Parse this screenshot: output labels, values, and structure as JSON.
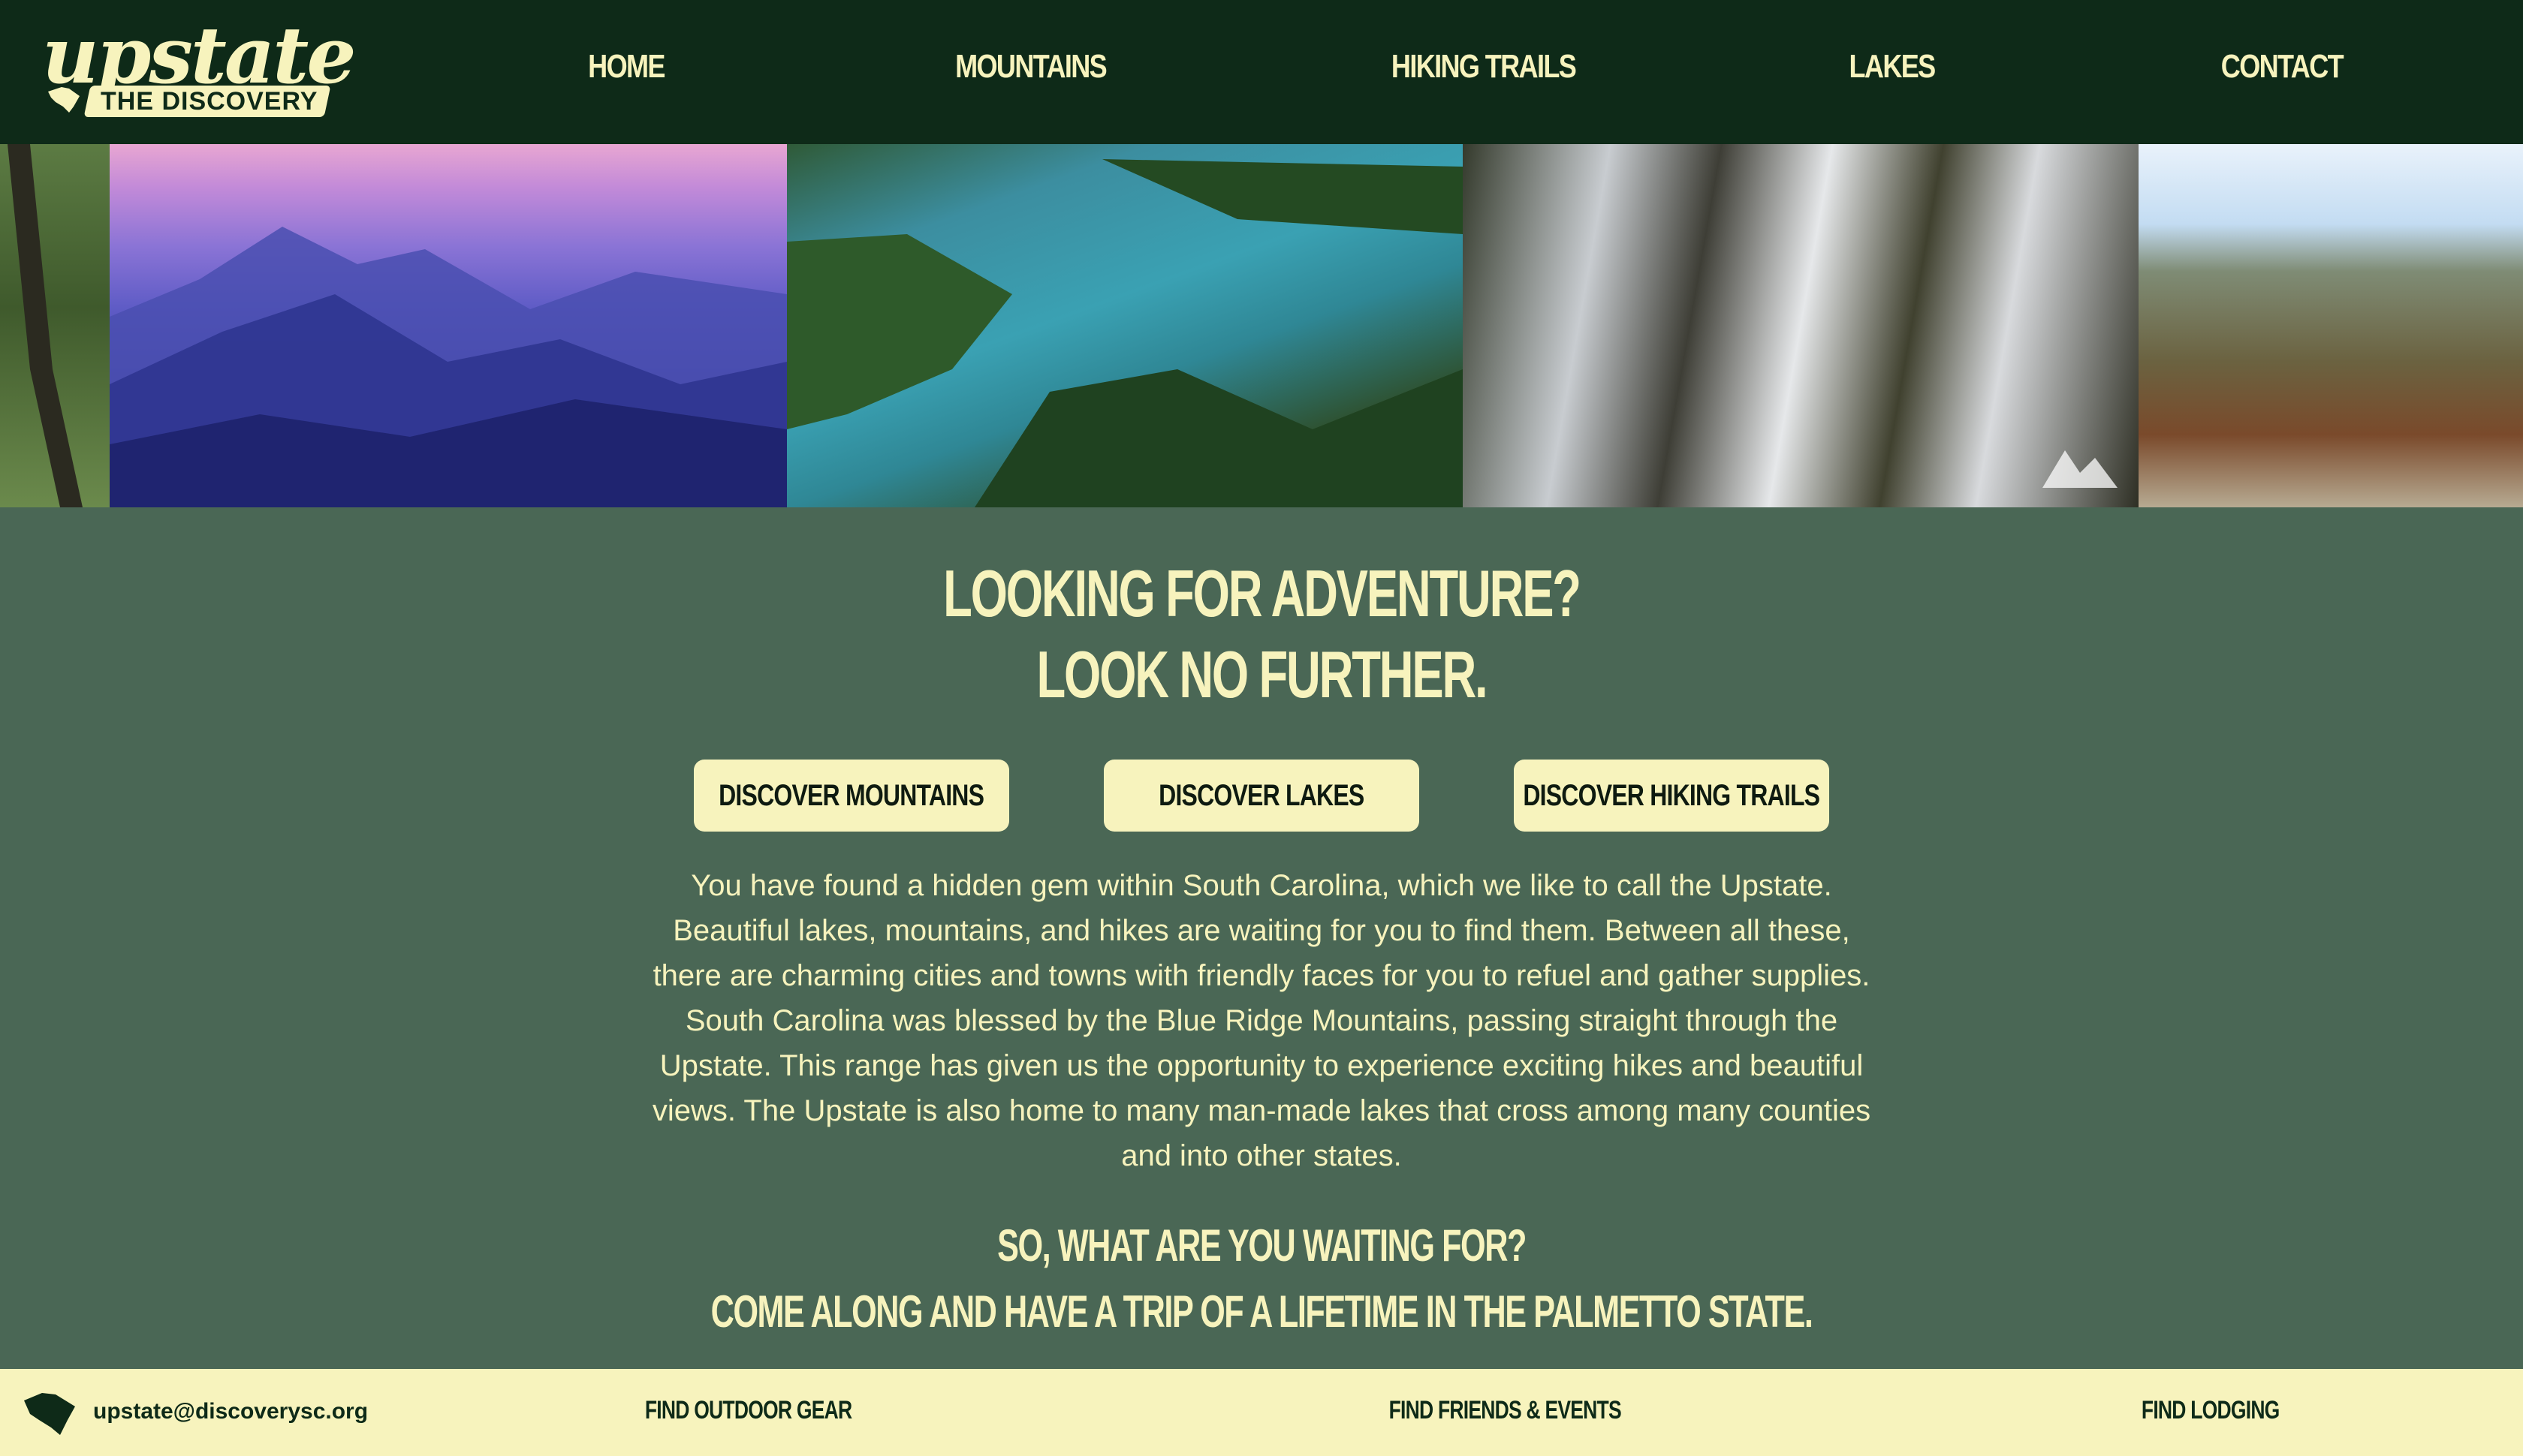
{
  "brand": {
    "logo_word": "upstate",
    "logo_sub": "THE DISCOVERY"
  },
  "nav": {
    "items": [
      {
        "label": "HOME"
      },
      {
        "label": "MOUNTAINS"
      },
      {
        "label": "HIKING TRAILS"
      },
      {
        "label": "LAKES"
      },
      {
        "label": "CONTACT"
      }
    ]
  },
  "banner": {
    "photos": [
      "forest-edge",
      "purple-mountains",
      "aerial-lake",
      "waterfall",
      "mountain-overlook"
    ]
  },
  "hero": {
    "line1": "LOOKING FOR ADVENTURE?",
    "line2": "LOOK NO FURTHER."
  },
  "buttons": {
    "mountains": "DISCOVER MOUNTAINS",
    "lakes": "DISCOVER LAKES",
    "trails": "DISCOVER HIKING TRAILS"
  },
  "intro": {
    "lines": [
      "You have found a hidden gem within South Carolina, which we like to call the Upstate.",
      "Beautiful lakes, mountains, and hikes are waiting for you to find them. Between all these,",
      "there are charming cities and towns with friendly faces for you to refuel and gather supplies.",
      "South Carolina was blessed by the Blue Ridge Mountains, passing straight through the",
      "Upstate. This range has given us the opportunity to experience exciting hikes and beautiful",
      "views. The Upstate is also home to many man-made lakes that cross among many counties",
      "and into other states."
    ]
  },
  "cta": {
    "line1": "SO, WHAT ARE YOU WAITING FOR?",
    "line2": "COME ALONG AND HAVE A TRIP OF A LIFETIME IN THE PALMETTO STATE."
  },
  "footer": {
    "email": "upstate@discoverysc.org",
    "gear": "FIND OUTDOOR GEAR",
    "events": "FIND FRIENDS & EVENTS",
    "lodging": "FIND LODGING"
  },
  "colors": {
    "header_bg": "#0e2a18",
    "main_bg": "#4a6755",
    "accent": "#f7f3bd"
  }
}
